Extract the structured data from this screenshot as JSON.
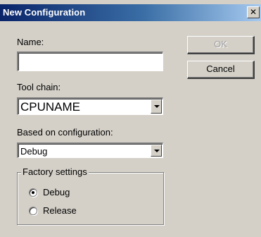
{
  "dialog": {
    "title": "New Configuration",
    "close_glyph": "✕"
  },
  "name": {
    "label": "Name:",
    "value": ""
  },
  "toolchain": {
    "label": "Tool chain:",
    "value": "CPUNAME"
  },
  "based_on": {
    "label": "Based on configuration:",
    "value": "Debug"
  },
  "buttons": {
    "ok": "OK",
    "cancel": "Cancel"
  },
  "factory": {
    "title": "Factory settings",
    "options": [
      {
        "label": "Debug",
        "checked": true
      },
      {
        "label": "Release",
        "checked": false
      }
    ]
  }
}
